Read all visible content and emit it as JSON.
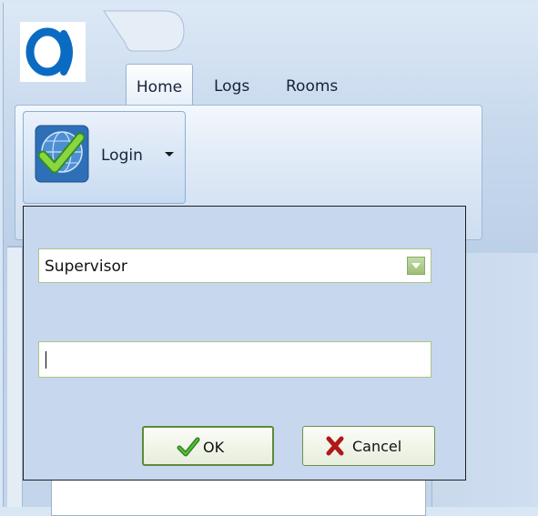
{
  "app": {
    "logo_icon": "app-logo-icon",
    "accent_color": "#0b6bc2"
  },
  "ribbon": {
    "tabs": [
      {
        "label": "Home",
        "selected": true
      },
      {
        "label": "Logs",
        "selected": false
      },
      {
        "label": "Rooms",
        "selected": false
      }
    ],
    "login_button": {
      "label": "Login",
      "icon": "login-check-globe-icon"
    }
  },
  "dialog": {
    "role_select": {
      "selected": "Supervisor",
      "icon": "chevron-down-icon"
    },
    "password_field": {
      "value": ""
    },
    "ok_button": {
      "label": "OK",
      "icon": "check-icon"
    },
    "cancel_button": {
      "label": "Cancel",
      "icon": "cross-icon"
    }
  }
}
